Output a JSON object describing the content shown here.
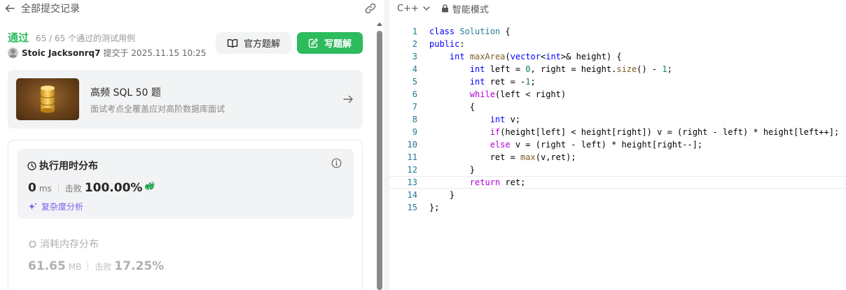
{
  "header": {
    "title": "全部提交记录"
  },
  "submission": {
    "status": "通过",
    "cases": "65 / 65 个通过的测试用例",
    "username": "Stoic Jacksonrq7",
    "submitted": "提交于 2025.11.15 10:25"
  },
  "buttons": {
    "official": "官方题解",
    "write": "写题解"
  },
  "promo": {
    "title": "高频 SQL 50 题",
    "subtitle": "面试考点全覆盖应对高阶数据库面试"
  },
  "runtime": {
    "title": "执行用时分布",
    "value": "0",
    "unit": "ms",
    "beat_label": "击败",
    "beat_value": "100.00%",
    "complexity": "复杂度分析"
  },
  "memory": {
    "title": "消耗内存分布",
    "value": "61.65",
    "unit": "MB",
    "beat_label": "击败",
    "beat_value": "17.25%"
  },
  "editor": {
    "language": "C++",
    "mode": "智能模式"
  },
  "code": {
    "active_line": 13,
    "lines": [
      "class Solution {",
      "public:",
      "    int maxArea(vector<int>& height) {",
      "        int left = 0, right = height.size() - 1;",
      "        int ret = -1;",
      "        while(left < right)",
      "        {",
      "            int v;",
      "            if(height[left] < height[right]) v = (right - left) * height[left++];",
      "            else v = (right - left) * height[right--];",
      "            ret = max(v,ret);",
      "        }",
      "        return ret;",
      "    }",
      "};"
    ]
  },
  "colors": {
    "accent_green": "#2cbb5d",
    "complexity_purple": "#7a5cf0",
    "keyword_blue": "#0000ff",
    "line_number": "#237893"
  }
}
